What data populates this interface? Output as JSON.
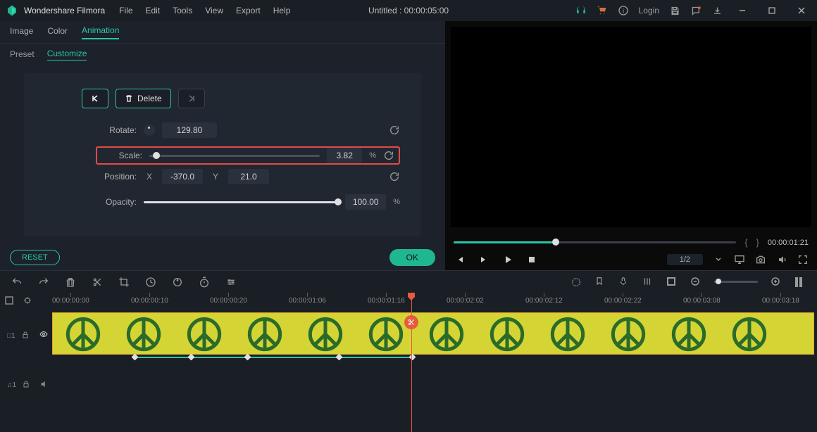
{
  "app": {
    "name": "Wondershare Filmora"
  },
  "menu": {
    "file": "File",
    "edit": "Edit",
    "tools": "Tools",
    "view": "View",
    "export": "Export",
    "help": "Help"
  },
  "title_center": "Untitled : 00:00:05:00",
  "titlebar": {
    "login": "Login"
  },
  "tabs": {
    "image": "Image",
    "color": "Color",
    "animation": "Animation"
  },
  "subtabs": {
    "preset": "Preset",
    "customize": "Customize"
  },
  "props": {
    "delete_label": "Delete",
    "rotate_label": "Rotate:",
    "rotate_value": "129.80",
    "scale_label": "Scale:",
    "scale_value": "3.82",
    "scale_percent": "%",
    "position_label": "Position:",
    "pos_x_label": "X",
    "pos_x": "-370.0",
    "pos_y_label": "Y",
    "pos_y": "21.0",
    "opacity_label": "Opacity:",
    "opacity_value": "100.00",
    "opacity_percent": "%"
  },
  "bottom": {
    "reset": "RESET",
    "ok": "OK"
  },
  "preview": {
    "time": "00:00:01:21",
    "page": "1/2"
  },
  "timeline": {
    "timecodes": [
      "00:00:00:00",
      "00:00:00:10",
      "00:00:00:20",
      "00:00:01:06",
      "00:00:01:16",
      "00:00:02:02",
      "00:00:02:12",
      "00:00:02:22",
      "00:00:03:08",
      "00:00:03:18"
    ]
  }
}
